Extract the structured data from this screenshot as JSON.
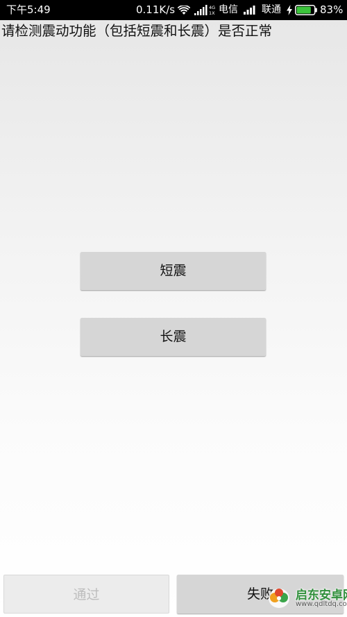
{
  "status_bar": {
    "time": "下午5:49",
    "net_speed": "0.11K/s",
    "network_type": "4G 1X",
    "carrier_1": "电信",
    "carrier_2": "联通",
    "battery_percent": "83%",
    "battery_level": 0.83,
    "icons": [
      "wifi-icon",
      "signal-4g-icon",
      "signal-icon",
      "charging-bolt-icon",
      "battery-icon"
    ]
  },
  "instruction": "请检测震动功能（包括短震和长震）是否正常",
  "buttons": {
    "short_vibration": "短震",
    "long_vibration": "长震",
    "pass": "通过",
    "fail": "失败"
  },
  "watermark": {
    "name": "启东安卓网",
    "url": "www.qdltdq.com"
  },
  "colors": {
    "status_bar_bg": "#000000",
    "button_bg": "#d6d6d6",
    "disabled_text": "#bdbdbd",
    "watermark_green": "#2f8f3a",
    "battery_fill": "#3cc43c"
  }
}
